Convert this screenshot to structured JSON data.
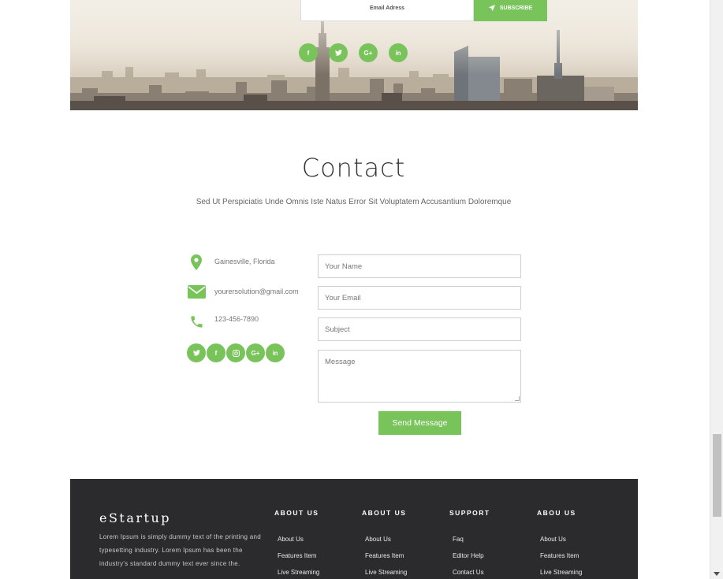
{
  "subscribe": {
    "email_placeholder": "Email Adress",
    "button_label": "SUBSCRIBE"
  },
  "hero_social": [
    {
      "icon": "facebook-icon",
      "glyph": "f"
    },
    {
      "icon": "twitter-icon",
      "glyph": "t"
    },
    {
      "icon": "google-plus-icon",
      "glyph": "G+"
    },
    {
      "icon": "linkedin-icon",
      "glyph": "in"
    }
  ],
  "contact": {
    "title": "Contact",
    "subtitle": "Sed Ut Perspiciatis Unde Omnis Iste Natus Error Sit Voluptatem Accusantium Doloremque",
    "address": "Gainesville, Florida",
    "email": "yourersolution@gmail.com",
    "phone": "123-456-7890",
    "social": [
      {
        "icon": "twitter-icon",
        "glyph": "t"
      },
      {
        "icon": "facebook-icon",
        "glyph": "f"
      },
      {
        "icon": "instagram-icon",
        "glyph": "◎"
      },
      {
        "icon": "google-plus-icon",
        "glyph": "G+"
      },
      {
        "icon": "linkedin-icon",
        "glyph": "in"
      }
    ],
    "form": {
      "name_placeholder": "Your Name",
      "email_placeholder": "Your Email",
      "subject_placeholder": "Subject",
      "message_placeholder": "Message",
      "send_label": "Send Message"
    }
  },
  "footer": {
    "brand": "eStartup",
    "about_text": "Lorem Ipsum is simply dummy text of the printing and typesetting industry. Lorem Ipsum has been the industry's standard dummy text ever since the.",
    "columns": [
      {
        "heading": "ABOUT US",
        "items": [
          "About Us",
          "Features Item",
          "Live Streaming"
        ]
      },
      {
        "heading": "ABOUT US",
        "items": [
          "About Us",
          "Features Item",
          "Live Streaming"
        ]
      },
      {
        "heading": "SUPPORT",
        "items": [
          "Faq",
          "Editor Help",
          "Contact Us"
        ]
      },
      {
        "heading": "ABOU US",
        "items": [
          "About Us",
          "Features Item",
          "Live Streaming"
        ]
      }
    ]
  },
  "colors": {
    "accent": "#79c35b",
    "footer_bg": "#2b2b2e"
  }
}
